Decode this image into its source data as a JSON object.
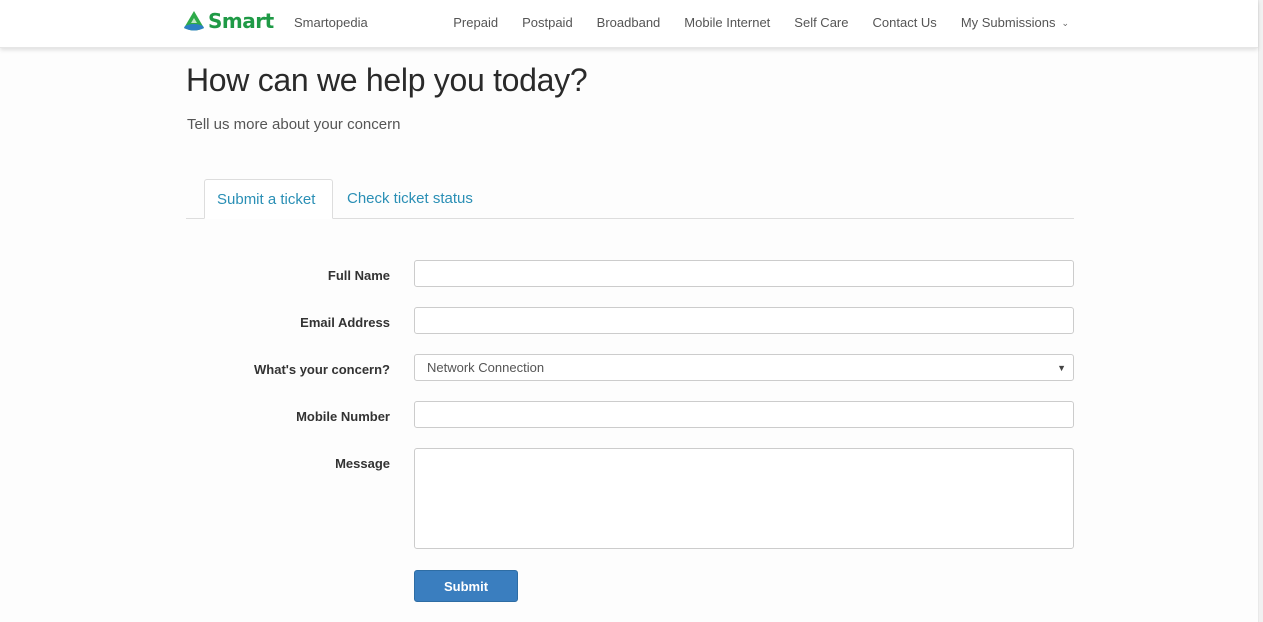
{
  "header": {
    "brand": "Smart",
    "brand_color": "#1f9a46",
    "secondary_link": "Smartopedia",
    "nav": [
      {
        "label": "Prepaid"
      },
      {
        "label": "Postpaid"
      },
      {
        "label": "Broadband"
      },
      {
        "label": "Mobile Internet"
      },
      {
        "label": "Self Care"
      },
      {
        "label": "Contact Us"
      },
      {
        "label": "My Submissions",
        "icon": "chevron-down-icon"
      }
    ]
  },
  "page": {
    "title": "How can we help you today?",
    "subtitle": "Tell us more about your concern"
  },
  "tabs": [
    {
      "label": "Submit a ticket",
      "active": true
    },
    {
      "label": "Check ticket status",
      "active": false
    }
  ],
  "form": {
    "full_name": {
      "label": "Full Name",
      "value": ""
    },
    "email": {
      "label": "Email Address",
      "value": ""
    },
    "concern": {
      "label": "What's your concern?",
      "selected": "Network Connection",
      "icon": "dropdown-arrow-icon"
    },
    "mobile": {
      "label": "Mobile Number",
      "value": ""
    },
    "message": {
      "label": "Message",
      "value": ""
    },
    "submit_label": "Submit",
    "accent_color": "#3a7ebf",
    "link_color": "#2a8fb5"
  }
}
